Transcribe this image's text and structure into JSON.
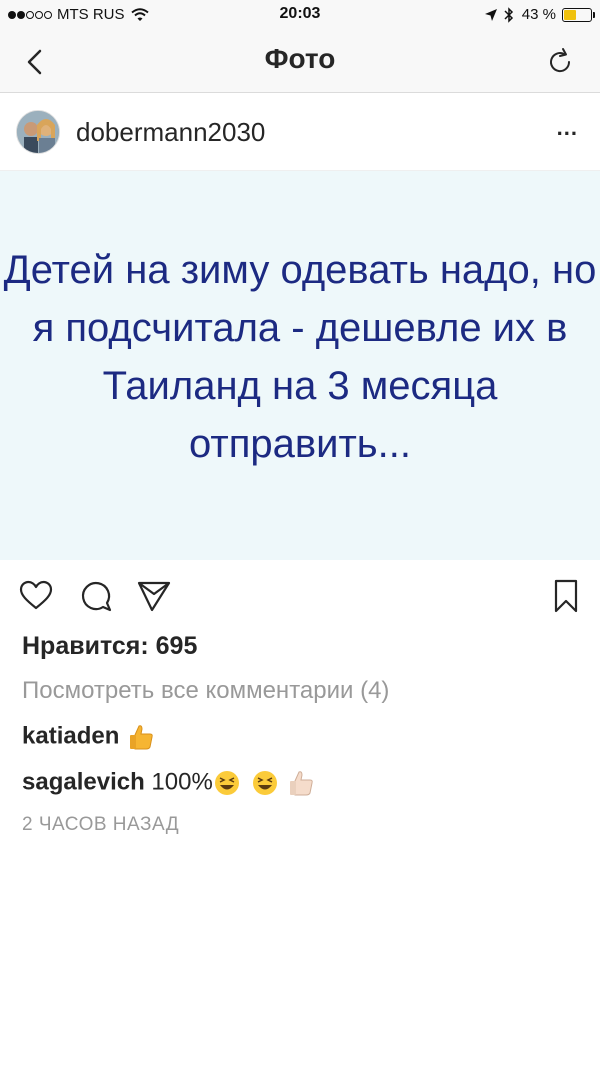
{
  "status_bar": {
    "carrier": "MTS RUS",
    "time": "20:03",
    "battery": "43 %",
    "battery_level": 0.43
  },
  "nav": {
    "title": "Фото"
  },
  "post": {
    "username": "dobermann2030",
    "more_label": "...",
    "image_text": "Детей на зиму одевать надо, но я подсчитала - дешевле их в Таиланд на 3 месяца отправить...",
    "likes": "Нравится: 695",
    "view_all_comments": "Посмотреть все комментарии (4)",
    "comments": [
      {
        "user": "katiaden",
        "text": "",
        "emoji": [
          "thumbs-up"
        ]
      },
      {
        "user": "sagalevich",
        "text": "100%",
        "emoji": [
          "grinning-squinting-face",
          "grinning-squinting-face",
          "thumbs-up-light-skin"
        ]
      }
    ],
    "timestamp": "2 ЧАСОВ НАЗАД"
  },
  "icons": {
    "like": "heart-icon",
    "comment": "comment-icon",
    "share": "send-icon",
    "save": "bookmark-icon",
    "back": "chevron-left-icon",
    "refresh": "refresh-icon"
  },
  "colors": {
    "image_background": "#eef8fa",
    "image_text": "#1c2a82",
    "muted_text": "#999999",
    "battery_fill": "#f0c20e"
  }
}
